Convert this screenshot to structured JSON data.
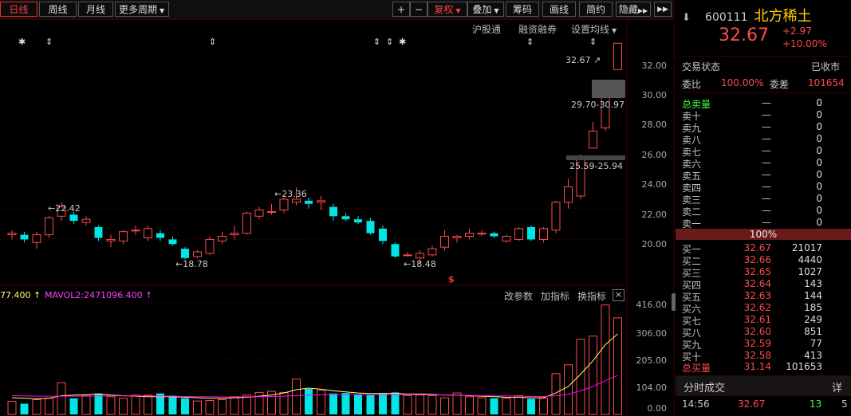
{
  "toolbar": {
    "periods": [
      "日线",
      "周线",
      "月线",
      "更多周期"
    ],
    "right_buttons": [
      "复权",
      "叠加",
      "筹码",
      "画线",
      "简约",
      "隐藏"
    ],
    "plus": "+",
    "minus": "−"
  },
  "subbar": [
    "沪股通",
    "融资融券",
    "设置均线"
  ],
  "price_axis": [
    "32.00",
    "30.00",
    "28.00",
    "26.00",
    "24.00",
    "22.00",
    "20.00"
  ],
  "volume_axis": [
    "416.00",
    "306.00",
    "205.00",
    "104.00",
    "0.00"
  ],
  "annotations": {
    "high_22": "←22.42",
    "high_23": "←23.36",
    "low_18_78": "←18.78",
    "low_18_48": "←18.48",
    "last": "32.67",
    "gap_upper": "29.70-30.97",
    "gap_lower": "25.59-25.94"
  },
  "volume_panel": {
    "mavol1": "77.400 ↑",
    "mavol2": "MAVOL2:2471096.400 ↑",
    "buttons": [
      "改参数",
      "加指标",
      "换指标"
    ],
    "close": "×"
  },
  "stock": {
    "code": "600111",
    "name": "北方稀土",
    "price": "32.67",
    "change": "+2.97",
    "change_pct": "+10.00%"
  },
  "status": {
    "label": "交易状态",
    "value": "已收市",
    "weibi_label": "委比",
    "weibi": "100.00%",
    "weicha_label": "委差",
    "weicha": "101654"
  },
  "sell": {
    "total_label": "总卖量",
    "total_dash": "—",
    "total_vol": "0",
    "levels": [
      {
        "name": "卖十",
        "price": "—",
        "vol": "0"
      },
      {
        "name": "卖九",
        "price": "—",
        "vol": "0"
      },
      {
        "name": "卖八",
        "price": "—",
        "vol": "0"
      },
      {
        "name": "卖七",
        "price": "—",
        "vol": "0"
      },
      {
        "name": "卖六",
        "price": "—",
        "vol": "0"
      },
      {
        "name": "卖五",
        "price": "—",
        "vol": "0"
      },
      {
        "name": "卖四",
        "price": "—",
        "vol": "0"
      },
      {
        "name": "卖三",
        "price": "—",
        "vol": "0"
      },
      {
        "name": "卖二",
        "price": "—",
        "vol": "0"
      },
      {
        "name": "卖一",
        "price": "—",
        "vol": "0"
      }
    ]
  },
  "mid_pct": "100%",
  "buy": {
    "levels": [
      {
        "name": "买一",
        "price": "32.67",
        "vol": "21017"
      },
      {
        "name": "买二",
        "price": "32.66",
        "vol": "4440"
      },
      {
        "name": "买三",
        "price": "32.65",
        "vol": "1027"
      },
      {
        "name": "买四",
        "price": "32.64",
        "vol": "143"
      },
      {
        "name": "买五",
        "price": "32.63",
        "vol": "144"
      },
      {
        "name": "买六",
        "price": "32.62",
        "vol": "185"
      },
      {
        "name": "买七",
        "price": "32.61",
        "vol": "249"
      },
      {
        "name": "买八",
        "price": "32.60",
        "vol": "851"
      },
      {
        "name": "买九",
        "price": "32.59",
        "vol": "77"
      },
      {
        "name": "买十",
        "price": "32.58",
        "vol": "413"
      }
    ],
    "total_label": "总买量",
    "total_price": "31.14",
    "total_vol": "101653"
  },
  "ticks": {
    "label": "分时成交",
    "detail": "详",
    "time": "14:56",
    "price": "32.67",
    "vol": "13",
    "count": "5"
  },
  "colors": {
    "up": "#ff4a4a",
    "down": "#00e5e5",
    "ma1": "#ffff66",
    "ma2": "#ff00ff"
  },
  "chart_data": {
    "type": "candlestick",
    "price_range": [
      17.5,
      33.2
    ],
    "volume_range": [
      0,
      416
    ],
    "candles": [
      {
        "o": 20.3,
        "h": 20.6,
        "l": 20.0,
        "c": 20.4
      },
      {
        "o": 20.3,
        "h": 20.5,
        "l": 19.8,
        "c": 20.0
      },
      {
        "o": 19.8,
        "h": 20.5,
        "l": 19.4,
        "c": 20.3
      },
      {
        "o": 20.3,
        "h": 21.5,
        "l": 20.1,
        "c": 21.4
      },
      {
        "o": 21.5,
        "h": 22.4,
        "l": 21.2,
        "c": 22.1
      },
      {
        "o": 21.6,
        "h": 21.8,
        "l": 21.0,
        "c": 21.2
      },
      {
        "o": 21.1,
        "h": 21.5,
        "l": 20.9,
        "c": 21.3
      },
      {
        "o": 20.8,
        "h": 20.9,
        "l": 19.9,
        "c": 20.1
      },
      {
        "o": 19.9,
        "h": 20.3,
        "l": 19.5,
        "c": 20.0
      },
      {
        "o": 19.9,
        "h": 20.6,
        "l": 19.7,
        "c": 20.5
      },
      {
        "o": 20.6,
        "h": 20.9,
        "l": 20.3,
        "c": 20.6
      },
      {
        "o": 20.1,
        "h": 20.9,
        "l": 19.9,
        "c": 20.7
      },
      {
        "o": 20.4,
        "h": 20.6,
        "l": 19.9,
        "c": 20.1
      },
      {
        "o": 20.0,
        "h": 20.2,
        "l": 19.6,
        "c": 19.7
      },
      {
        "o": 19.4,
        "h": 19.5,
        "l": 18.7,
        "c": 18.8
      },
      {
        "o": 18.9,
        "h": 19.3,
        "l": 18.78,
        "c": 19.2
      },
      {
        "o": 19.1,
        "h": 20.2,
        "l": 19.0,
        "c": 20.0
      },
      {
        "o": 19.9,
        "h": 20.5,
        "l": 19.7,
        "c": 20.2
      },
      {
        "o": 20.3,
        "h": 20.9,
        "l": 20.0,
        "c": 20.4
      },
      {
        "o": 20.4,
        "h": 21.8,
        "l": 20.3,
        "c": 21.7
      },
      {
        "o": 21.5,
        "h": 22.1,
        "l": 21.3,
        "c": 21.9
      },
      {
        "o": 21.8,
        "h": 22.3,
        "l": 21.6,
        "c": 21.8
      },
      {
        "o": 21.9,
        "h": 22.7,
        "l": 21.7,
        "c": 22.6
      },
      {
        "o": 22.4,
        "h": 23.36,
        "l": 22.2,
        "c": 22.6
      },
      {
        "o": 22.5,
        "h": 22.7,
        "l": 22.0,
        "c": 22.3
      },
      {
        "o": 22.4,
        "h": 22.8,
        "l": 21.9,
        "c": 22.5
      },
      {
        "o": 22.1,
        "h": 22.3,
        "l": 21.2,
        "c": 21.5
      },
      {
        "o": 21.5,
        "h": 21.7,
        "l": 21.2,
        "c": 21.3
      },
      {
        "o": 21.3,
        "h": 21.5,
        "l": 21.0,
        "c": 21.1
      },
      {
        "o": 21.2,
        "h": 21.4,
        "l": 20.3,
        "c": 20.4
      },
      {
        "o": 20.7,
        "h": 20.9,
        "l": 19.7,
        "c": 19.9
      },
      {
        "o": 19.7,
        "h": 19.8,
        "l": 18.8,
        "c": 18.9
      },
      {
        "o": 19.0,
        "h": 19.2,
        "l": 18.9,
        "c": 19.0
      },
      {
        "o": 18.8,
        "h": 19.3,
        "l": 18.48,
        "c": 19.1
      },
      {
        "o": 19.0,
        "h": 19.6,
        "l": 18.9,
        "c": 19.4
      },
      {
        "o": 19.5,
        "h": 20.6,
        "l": 19.3,
        "c": 20.2
      },
      {
        "o": 20.1,
        "h": 20.3,
        "l": 19.8,
        "c": 20.2
      },
      {
        "o": 20.2,
        "h": 20.7,
        "l": 20.0,
        "c": 20.4
      },
      {
        "o": 20.4,
        "h": 20.6,
        "l": 20.2,
        "c": 20.4
      },
      {
        "o": 20.4,
        "h": 20.5,
        "l": 20.1,
        "c": 20.2
      },
      {
        "o": 19.9,
        "h": 20.3,
        "l": 19.8,
        "c": 20.2
      },
      {
        "o": 20.0,
        "h": 20.8,
        "l": 19.9,
        "c": 20.7
      },
      {
        "o": 20.8,
        "h": 20.9,
        "l": 19.9,
        "c": 20.0
      },
      {
        "o": 20.0,
        "h": 20.8,
        "l": 19.8,
        "c": 20.7
      },
      {
        "o": 20.6,
        "h": 22.5,
        "l": 20.4,
        "c": 22.4
      },
      {
        "o": 22.4,
        "h": 23.9,
        "l": 22.0,
        "c": 23.4
      },
      {
        "o": 22.8,
        "h": 25.5,
        "l": 22.6,
        "c": 25.2
      },
      {
        "o": 25.9,
        "h": 27.6,
        "l": 25.9,
        "c": 27.0
      },
      {
        "o": 27.2,
        "h": 29.7,
        "l": 27.0,
        "c": 29.7
      },
      {
        "o": 30.97,
        "h": 32.67,
        "l": 30.97,
        "c": 32.67
      }
    ],
    "volumes": [
      49,
      40,
      55,
      60,
      118,
      60,
      70,
      78,
      66,
      60,
      72,
      72,
      78,
      70,
      60,
      50,
      52,
      55,
      66,
      72,
      82,
      86,
      82,
      132,
      95,
      90,
      78,
      80,
      75,
      72,
      80,
      82,
      70,
      72,
      70,
      62,
      80,
      66,
      62,
      60,
      60,
      70,
      58,
      60,
      152,
      185,
      280,
      292,
      408,
      360
    ],
    "mavol1": [
      62,
      60,
      58,
      60,
      70,
      72,
      74,
      76,
      72,
      70,
      68,
      66,
      66,
      66,
      64,
      62,
      60,
      60,
      62,
      64,
      68,
      72,
      80,
      92,
      98,
      94,
      88,
      84,
      80,
      78,
      78,
      78,
      76,
      76,
      75,
      72,
      72,
      70,
      68,
      66,
      64,
      64,
      62,
      62,
      80,
      104,
      150,
      200,
      260,
      300
    ],
    "mavol2": [
      70,
      69,
      68,
      68,
      68,
      68,
      68,
      69,
      69,
      69,
      69,
      69,
      68,
      68,
      67,
      66,
      66,
      65,
      65,
      66,
      66,
      67,
      68,
      70,
      72,
      73,
      74,
      74,
      74,
      74,
      74,
      74,
      74,
      73,
      73,
      72,
      72,
      71,
      70,
      69,
      69,
      68,
      67,
      67,
      70,
      75,
      88,
      104,
      126,
      145
    ]
  }
}
